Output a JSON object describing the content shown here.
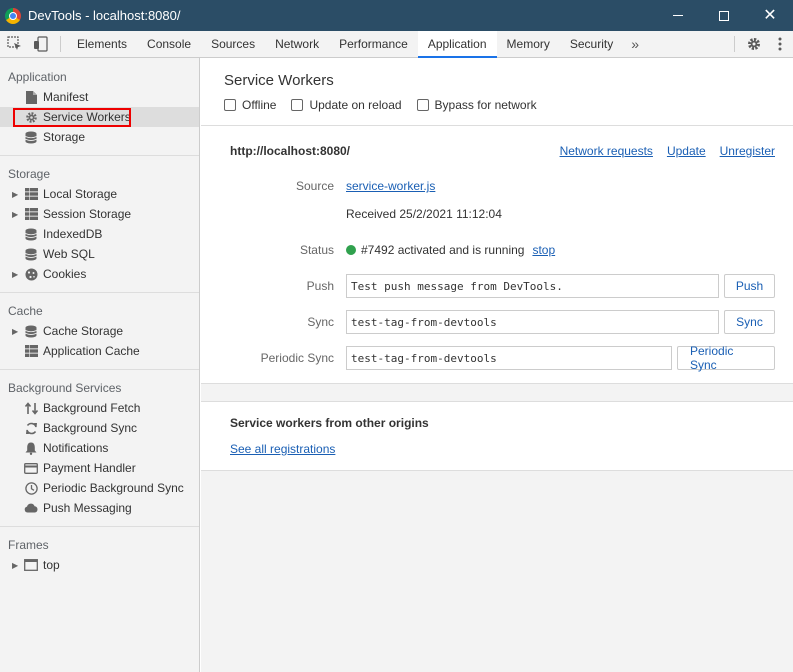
{
  "window": {
    "title": "DevTools - localhost:8080/"
  },
  "toolbar": {
    "tabs": [
      "Elements",
      "Console",
      "Sources",
      "Network",
      "Performance",
      "Application",
      "Memory",
      "Security"
    ],
    "active_tab": "Application",
    "more": "»"
  },
  "sidebar": {
    "sections": [
      {
        "title": "Application",
        "items": [
          {
            "label": "Manifest",
            "icon": "document-icon"
          },
          {
            "label": "Service Workers",
            "icon": "gear-icon"
          },
          {
            "label": "Storage",
            "icon": "database-icon"
          }
        ]
      },
      {
        "title": "Storage",
        "items": [
          {
            "label": "Local Storage",
            "icon": "grid-icon"
          },
          {
            "label": "Session Storage",
            "icon": "grid-icon"
          },
          {
            "label": "IndexedDB",
            "icon": "database-icon"
          },
          {
            "label": "Web SQL",
            "icon": "database-icon"
          },
          {
            "label": "Cookies",
            "icon": "cookie-icon"
          }
        ]
      },
      {
        "title": "Cache",
        "items": [
          {
            "label": "Cache Storage",
            "icon": "database-icon"
          },
          {
            "label": "Application Cache",
            "icon": "grid-icon"
          }
        ]
      },
      {
        "title": "Background Services",
        "items": [
          {
            "label": "Background Fetch",
            "icon": "up-down-arrows-icon"
          },
          {
            "label": "Background Sync",
            "icon": "sync-icon"
          },
          {
            "label": "Notifications",
            "icon": "bell-icon"
          },
          {
            "label": "Payment Handler",
            "icon": "card-icon"
          },
          {
            "label": "Periodic Background Sync",
            "icon": "clock-icon"
          },
          {
            "label": "Push Messaging",
            "icon": "cloud-icon"
          }
        ]
      },
      {
        "title": "Frames",
        "items": [
          {
            "label": "top",
            "icon": "frame-icon"
          }
        ]
      }
    ]
  },
  "main": {
    "title": "Service Workers",
    "options": [
      "Offline",
      "Update on reload",
      "Bypass for network"
    ],
    "origin": "http://localhost:8080/",
    "origin_links": [
      "Network requests",
      "Update",
      "Unregister"
    ],
    "source_label": "Source",
    "source_value": "service-worker.js",
    "received": "Received 25/2/2021 11:12:04",
    "status_label": "Status",
    "status_text": "#7492 activated and is running",
    "status_link": "stop",
    "push_label": "Push",
    "push_value": "Test push message from DevTools.",
    "push_button": "Push",
    "sync_label": "Sync",
    "sync_value": "test-tag-from-devtools",
    "sync_button": "Sync",
    "periodic_label": "Periodic Sync",
    "periodic_value": "test-tag-from-devtools",
    "periodic_button": "Periodic Sync",
    "others_title": "Service workers from other origins",
    "others_link": "See all registrations"
  },
  "colors": {
    "titlebar": "#2b4d66",
    "link": "#1a5fb4",
    "status_green": "#30a14e",
    "highlight": "#e00000"
  }
}
